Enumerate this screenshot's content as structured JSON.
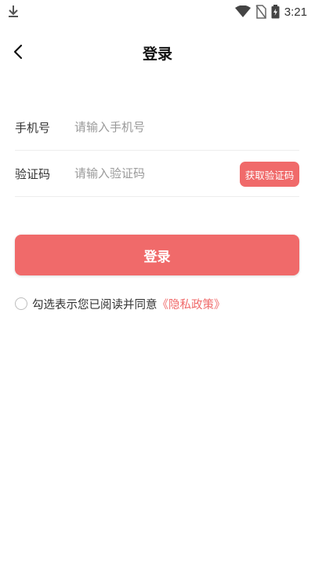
{
  "status_bar": {
    "time": "3:21",
    "icons": [
      "download-icon",
      "wifi-icon",
      "no-sim-icon",
      "battery-charging-icon"
    ]
  },
  "header": {
    "title": "登录",
    "back_icon": "chevron-left-icon"
  },
  "form": {
    "phone": {
      "label": "手机号",
      "placeholder": "请输入手机号",
      "value": ""
    },
    "code": {
      "label": "验证码",
      "placeholder": "请输入验证码",
      "value": "",
      "button": "获取验证码"
    }
  },
  "login_button": "登录",
  "agreement": {
    "text": "勾选表示您已阅读并同意",
    "policy_link": "《隐私政策》",
    "checked": false
  },
  "colors": {
    "accent": "#f06a6a",
    "background": "#ffffff",
    "placeholder": "#9a9a9a",
    "divider": "#ededed"
  }
}
